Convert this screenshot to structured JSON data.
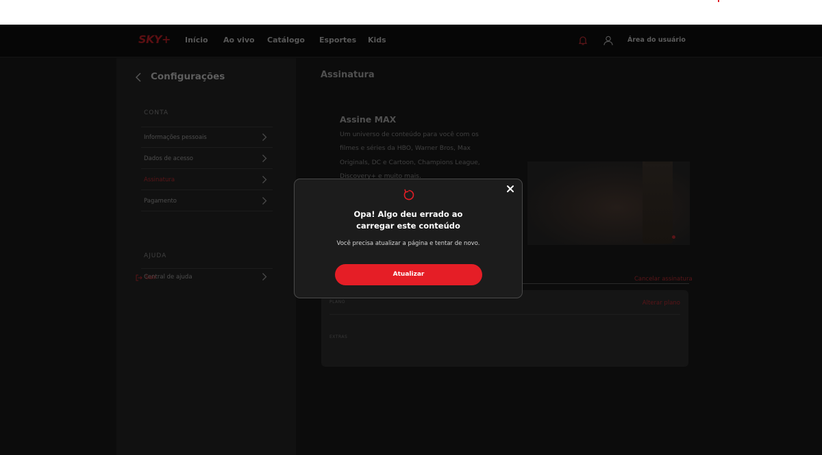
{
  "nav": {
    "logo": "SKY+",
    "items": [
      {
        "label": "Início"
      },
      {
        "label": "Ao vivo"
      },
      {
        "label": "Catálogo"
      },
      {
        "label": "Esportes"
      },
      {
        "label": "Kids"
      }
    ],
    "user_area": "Área do usuário",
    "bell_icon": "bell-icon",
    "user_icon": "user-icon"
  },
  "sidebar": {
    "title": "Configurações",
    "sections": [
      {
        "label": "CONTA"
      },
      {
        "label": "AJUDA"
      }
    ],
    "items": [
      {
        "label": "Informações pessoais"
      },
      {
        "label": "Dados de acesso"
      },
      {
        "label": "Assinatura"
      },
      {
        "label": "Pagamento"
      },
      {
        "label": "Central de ajuda"
      }
    ],
    "logout": "Sair"
  },
  "main": {
    "page_title": "Assinatura",
    "promo": {
      "title": "Assine MAX",
      "text": "Um universo de conteúdo para você com os filmes e séries da HBO, Warner Bros, Max Originals, DC e Cartoon, Champions League, Discovery+ e muito mais."
    },
    "cancel_link": "Cancelar assinatura",
    "plan_card": {
      "plan_label": "PLANO",
      "change_plan": "Alterar plano",
      "extras_label": "EXTRAS"
    }
  },
  "modal": {
    "title": "Opa! Algo deu errado ao carregar este conteúdo",
    "message": "Você precisa atualizar a página e tentar de novo.",
    "button": "Atualizar",
    "close_icon": "close-icon",
    "reload_icon": "reload-icon"
  },
  "colors": {
    "accent": "#e51e26",
    "modal_bg": "#1c1c1c",
    "app_bg": "#0c0c0c"
  }
}
